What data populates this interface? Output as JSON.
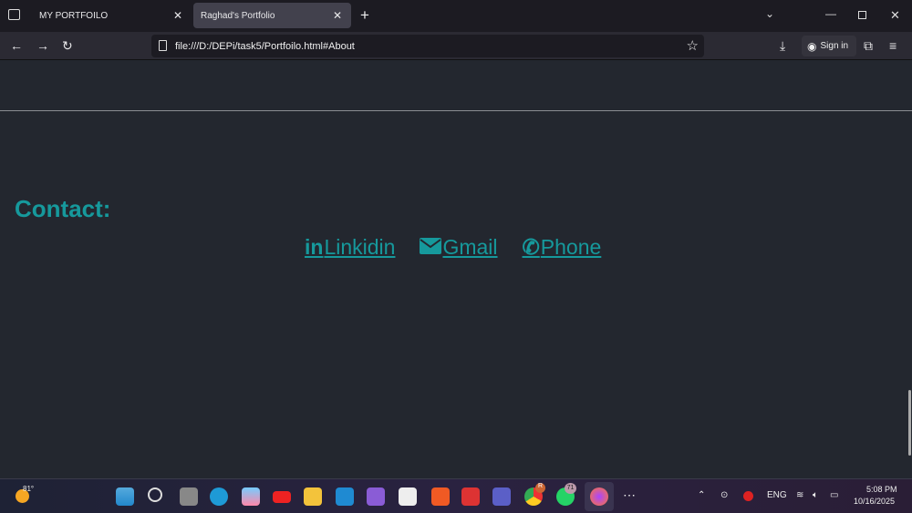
{
  "browser": {
    "tabs": [
      {
        "label": "MY PORTFOILO",
        "active": false
      },
      {
        "label": "Raghad's Portfolio",
        "active": true
      }
    ],
    "url": "file:///D:/DEPi/task5/Portfoilo.html#About",
    "sign_in": "Sign in"
  },
  "page": {
    "contact_heading": "Contact:",
    "links": [
      {
        "icon": "linkedin-icon",
        "icon_text": "in",
        "label": "Linkidin"
      },
      {
        "icon": "mail-icon",
        "label": "Gmail"
      },
      {
        "icon": "phone-icon",
        "label": "Phone"
      }
    ],
    "accent": "#16999c"
  },
  "taskbar": {
    "weather": "81°",
    "badges": {
      "chrome": "R",
      "whatsapp": "71"
    },
    "lang": "ENG",
    "time": "5:08 PM",
    "date": "10/16/2025"
  }
}
